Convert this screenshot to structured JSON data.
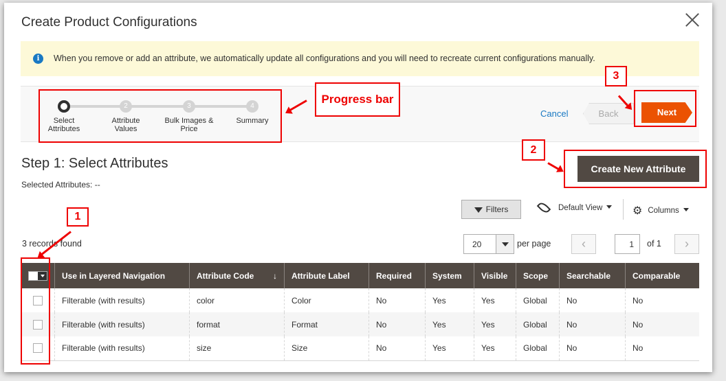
{
  "modal": {
    "title": "Create Product Configurations"
  },
  "notice": {
    "text": "When you remove or add an attribute, we automatically update all configurations and you will need to recreate current configurations manually."
  },
  "steps": [
    {
      "num": "",
      "label": "Select Attributes"
    },
    {
      "num": "2",
      "label": "Attribute Values"
    },
    {
      "num": "3",
      "label": "Bulk Images & Price"
    },
    {
      "num": "4",
      "label": "Summary"
    }
  ],
  "nav": {
    "cancel": "Cancel",
    "back": "Back",
    "next": "Next"
  },
  "page": {
    "step_title": "Step 1: Select Attributes",
    "selected": "Selected Attributes: --",
    "create_button": "Create New Attribute"
  },
  "grid_toolbar": {
    "filters": "Filters",
    "view": "Default View",
    "columns": "Columns",
    "records": "3 records found",
    "per_page_value": "20",
    "per_page_label": "per page",
    "page_prev": "‹",
    "page_current": "1",
    "page_of": "of 1",
    "page_next": "›"
  },
  "table": {
    "headers": [
      "Use in Layered Navigation",
      "Attribute Code",
      "Attribute Label",
      "Required",
      "System",
      "Visible",
      "Scope",
      "Searchable",
      "Comparable"
    ],
    "sort_indicator": "↓",
    "rows": [
      [
        "Filterable (with results)",
        "color",
        "Color",
        "No",
        "Yes",
        "Yes",
        "Global",
        "No",
        "No"
      ],
      [
        "Filterable (with results)",
        "format",
        "Format",
        "No",
        "Yes",
        "Yes",
        "Global",
        "No",
        "No"
      ],
      [
        "Filterable (with results)",
        "size",
        "Size",
        "No",
        "Yes",
        "Yes",
        "Global",
        "No",
        "No"
      ]
    ]
  },
  "annotations": {
    "progress_label": "Progress bar",
    "badge1": "1",
    "badge2": "2",
    "badge3": "3",
    "color": "#e00000"
  },
  "colors": {
    "accent": "#eb5202",
    "header": "#514943",
    "link": "#1979c3",
    "notice_bg": "#fdf9d8"
  },
  "icons": {
    "info": "info-icon",
    "close": "close-icon",
    "filter": "funnel-icon",
    "eye": "eye-icon",
    "gear": "gear-icon"
  }
}
